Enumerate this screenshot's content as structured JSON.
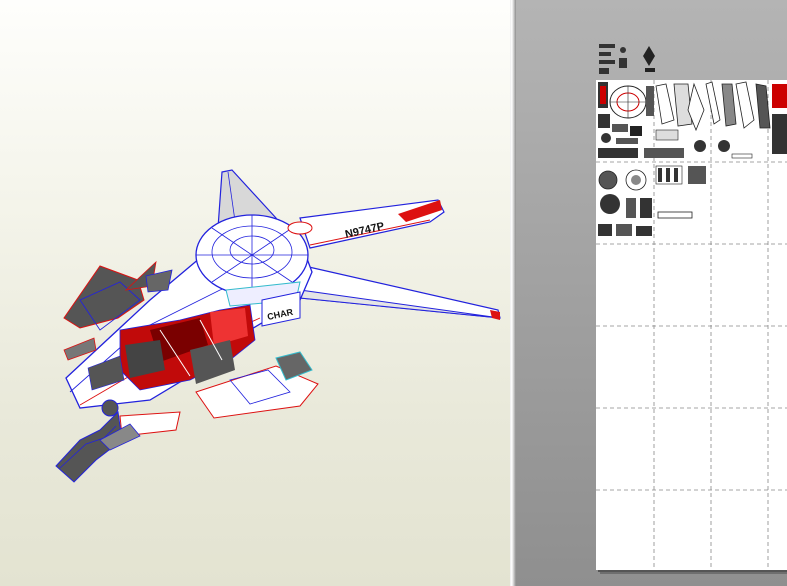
{
  "model": {
    "name": "papercraft-aircraft-model",
    "livery_text": "N9747P",
    "side_text": "CHAR",
    "colors": {
      "edge_blue": "#2222dd",
      "fold_red": "#dd1111",
      "hull_white": "#ffffff",
      "panel_gray": "#555555"
    }
  },
  "view2d": {
    "page": {
      "columns": 4,
      "rows": 6
    }
  },
  "icons": [
    "viewport-3d",
    "unfolded-parts-sheet"
  ]
}
